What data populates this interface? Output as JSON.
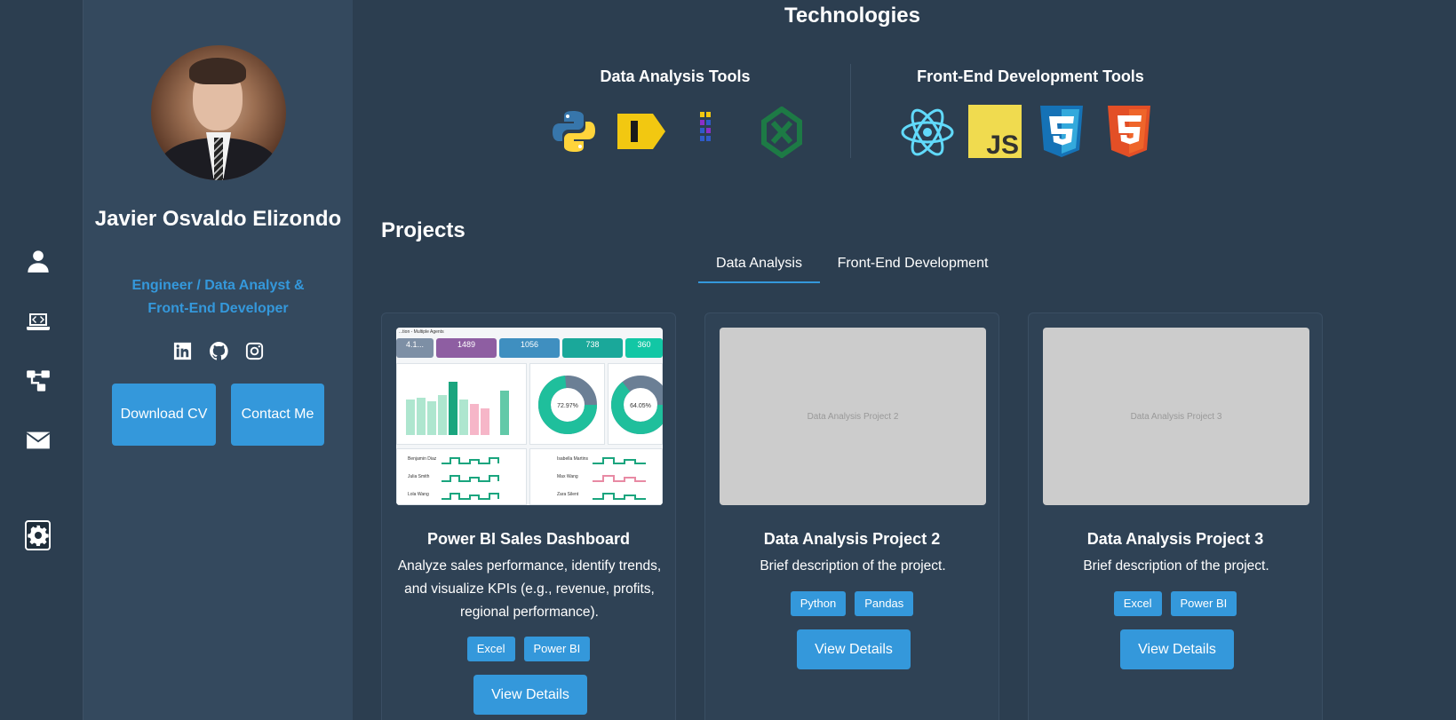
{
  "nav": {
    "items": [
      {
        "name": "about-nav-icon",
        "icon": "user-icon"
      },
      {
        "name": "projects-nav-icon",
        "icon": "laptop-code-icon"
      },
      {
        "name": "skills-nav-icon",
        "icon": "diagram-icon"
      },
      {
        "name": "contact-nav-icon",
        "icon": "envelope-icon"
      }
    ],
    "settings_icon": "gear-icon"
  },
  "profile": {
    "name": "Javier Osvaldo Elizondo",
    "role": "Engineer / Data Analyst & Front-End Developer",
    "socials": [
      "linkedin-icon",
      "github-icon",
      "instagram-icon"
    ],
    "download_cv": "Download CV",
    "contact_me": "Contact Me"
  },
  "technologies": {
    "title": "Technologies",
    "groups": [
      {
        "title": "Data Analysis Tools",
        "icons": [
          "python-icon",
          "power-bi-icon",
          "polars-icon",
          "excel-icon"
        ]
      },
      {
        "title": "Front-End Development Tools",
        "icons": [
          "react-icon",
          "javascript-icon",
          "css3-icon",
          "html5-icon"
        ]
      }
    ]
  },
  "projects": {
    "title": "Projects",
    "tabs": [
      {
        "label": "Data Analysis",
        "active": true
      },
      {
        "label": "Front-End Development",
        "active": false
      }
    ],
    "cards": [
      {
        "title": "Power BI Sales Dashboard",
        "description": "Analyze sales performance, identify trends, and visualize KPIs (e.g., revenue, profits, regional performance).",
        "tags": [
          "Excel",
          "Power BI"
        ],
        "button": "View Details",
        "image_text": "",
        "thumbnail": {
          "header": "...tion - Multiple Agents",
          "kpis": [
            "4.1...",
            "1489",
            "1056",
            "738",
            "360"
          ],
          "donuts": [
            "72.97%",
            "64.05%"
          ],
          "agents": [
            "Benjamin Diaz",
            "Julia Smith",
            "Lola Wang",
            "Isabella Martins",
            "Max Wang",
            "Zara Silent"
          ]
        }
      },
      {
        "title": "Data Analysis Project 2",
        "description": "Brief description of the project.",
        "tags": [
          "Python",
          "Pandas"
        ],
        "button": "View Details",
        "image_text": "Data Analysis Project 2"
      },
      {
        "title": "Data Analysis Project 3",
        "description": "Brief description of the project.",
        "tags": [
          "Excel",
          "Power BI"
        ],
        "button": "View Details",
        "image_text": "Data Analysis Project 3"
      }
    ]
  },
  "colors": {
    "background": "#2c3e50",
    "sidebar": "#34495e",
    "accent": "#3498db"
  }
}
